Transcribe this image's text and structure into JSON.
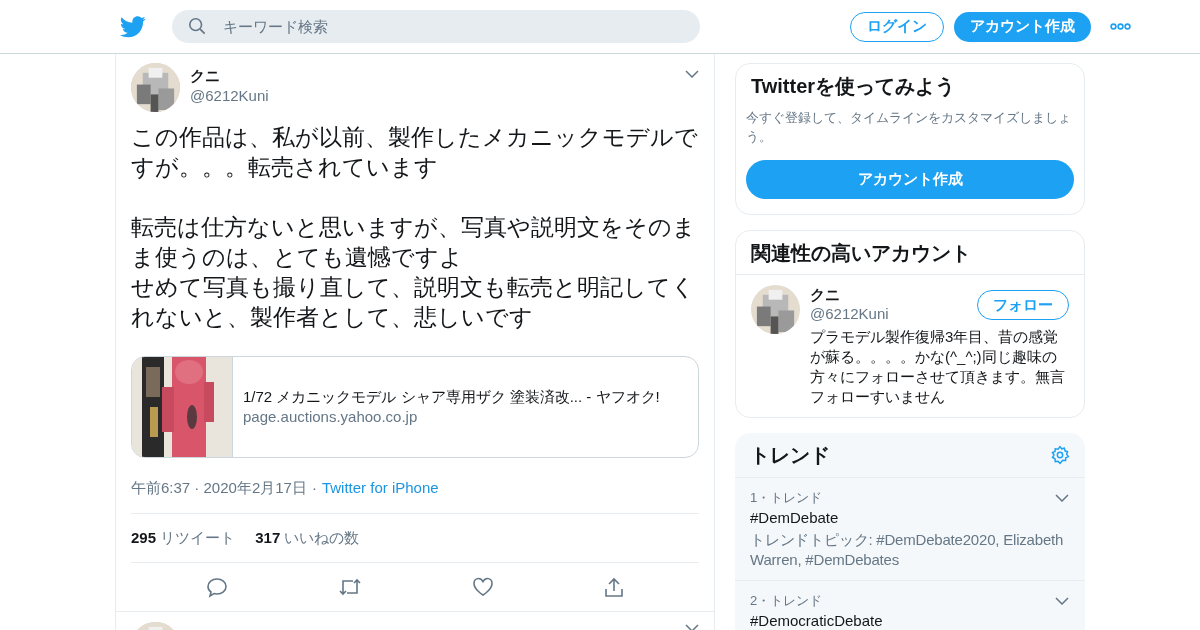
{
  "header": {
    "search": {
      "placeholder": "キーワード検索"
    },
    "login_button": "ログイン",
    "signup_button": "アカウント作成"
  },
  "tweet": {
    "name": "クニ",
    "handle": "@6212Kuni",
    "paragraphs": [
      [
        "この作品は、私が以前、製作したメカニックモデルですが。。。転売されています"
      ],
      [
        "転売は仕方ないと思いますが、写真や説明文をそのまま使うのは、とても遺憾ですよ",
        "せめて写真も撮り直して、説明文も転売と明記してくれないと、製作者として、悲しいです"
      ]
    ],
    "card": {
      "kind": "picture",
      "title": "1/72 メカニックモデル シャア専用ザク 塗装済改... - ヤフオク!",
      "domain": "page.auctions.yahoo.co.jp"
    },
    "time": "午前6:37 · 2020年2月17日",
    "separator": "·",
    "source": "Twitter for iPhone",
    "stats": [
      {
        "count": "295",
        "label": "リツイート"
      },
      {
        "count": "317",
        "label": "いいねの数"
      }
    ]
  },
  "signup_card": {
    "title": "Twitterを使ってみよう",
    "text": "今すぐ登録して、タイムラインをカスタマイズしましょう。",
    "button": "アカウント作成"
  },
  "related": {
    "title": "関連性の高いアカウント",
    "accounts": [
      {
        "name": "クニ",
        "handle": "@6212Kuni",
        "follow_button": "フォロー",
        "bio": "プラモデル製作復帰3年目、昔の感覚が蘇る。。。。かな(^_^;)同じ趣味の方々にフォローさせて頂きます。無言フォローすいません"
      }
    ]
  },
  "trends": {
    "title": "トレンド",
    "items": [
      {
        "meta": "1・トレンド",
        "name": "#DemDebate",
        "topics": "トレンドトピック: #DemDebate2020, Elizabeth Warren, #DemDebates"
      },
      {
        "meta": "2・トレンド",
        "name": "#DemocraticDebate"
      }
    ]
  }
}
